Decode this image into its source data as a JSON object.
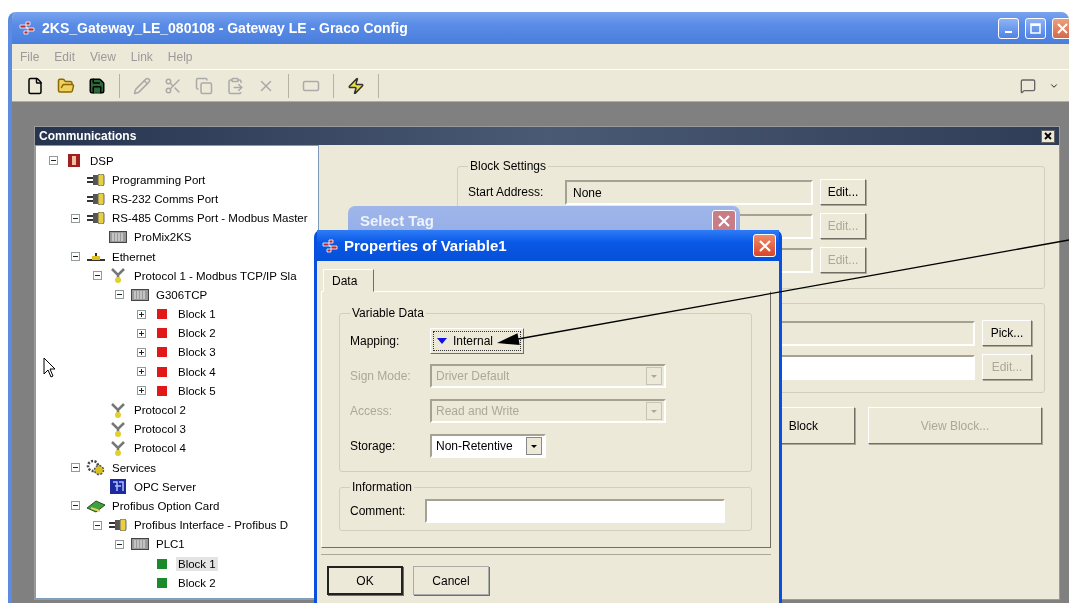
{
  "window": {
    "title": "2KS_Gateway_LE_080108 - Gateway LE - Graco Config"
  },
  "menu": [
    "File",
    "Edit",
    "View",
    "Link",
    "Help"
  ],
  "child_window": {
    "title": "Communications",
    "tree": [
      {
        "label": "DSP",
        "kind": "rack",
        "expanded": true,
        "selected": false,
        "children": [
          {
            "label": "Programming Port",
            "kind": "port",
            "selected": false
          },
          {
            "label": "RS-232 Comms Port",
            "kind": "port",
            "selected": false
          },
          {
            "label": "RS-485 Comms Port - Modbus Master",
            "kind": "port",
            "expanded": true,
            "selected": false,
            "children": [
              {
                "label": "ProMix2KS",
                "kind": "device",
                "selected": false
              }
            ]
          },
          {
            "label": "Ethernet",
            "kind": "network",
            "expanded": true,
            "selected": false,
            "children": [
              {
                "label": "Protocol 1 - Modbus TCP/IP Sla",
                "kind": "protocol",
                "expanded": true,
                "selected": false,
                "children": [
                  {
                    "label": "G306TCP",
                    "kind": "device",
                    "expanded": true,
                    "selected": false,
                    "children": [
                      {
                        "label": "Block 1",
                        "kind": "block",
                        "color": "#e01818",
                        "expanded": false,
                        "selected": false
                      },
                      {
                        "label": "Block 2",
                        "kind": "block",
                        "color": "#e01818",
                        "expanded": false,
                        "selected": false
                      },
                      {
                        "label": "Block 3",
                        "kind": "block",
                        "color": "#e01818",
                        "expanded": false,
                        "selected": false
                      },
                      {
                        "label": "Block 4",
                        "kind": "block",
                        "color": "#e01818",
                        "expanded": false,
                        "selected": false
                      },
                      {
                        "label": "Block 5",
                        "kind": "block",
                        "color": "#e01818",
                        "expanded": false,
                        "selected": false
                      }
                    ]
                  }
                ]
              },
              {
                "label": "Protocol 2",
                "kind": "protocol",
                "selected": false
              },
              {
                "label": "Protocol 3",
                "kind": "protocol",
                "selected": false
              },
              {
                "label": "Protocol 4",
                "kind": "protocol",
                "selected": false
              }
            ]
          },
          {
            "label": "Services",
            "kind": "services",
            "expanded": true,
            "selected": false,
            "children": [
              {
                "label": "OPC Server",
                "kind": "server",
                "selected": false
              }
            ]
          },
          {
            "label": "Profibus Option Card",
            "kind": "card",
            "expanded": true,
            "selected": false,
            "children": [
              {
                "label": "Profibus Interface - Profibus D",
                "kind": "port",
                "expanded": true,
                "selected": false,
                "children": [
                  {
                    "label": "PLC1",
                    "kind": "device",
                    "expanded": true,
                    "selected": false,
                    "children": [
                      {
                        "label": "Block 1",
                        "kind": "block",
                        "color": "#1a8a2a",
                        "selected": true
                      },
                      {
                        "label": "Block 2",
                        "kind": "block",
                        "color": "#1a8a2a",
                        "selected": false
                      }
                    ]
                  }
                ]
              }
            ]
          }
        ]
      }
    ],
    "block_settings": {
      "title": "Block Settings",
      "start_address": {
        "label": "Start Address:",
        "value": "None"
      },
      "buttons": [
        {
          "label": "Edit...",
          "disabled": false
        },
        {
          "label": "Edit...",
          "disabled": true
        },
        {
          "label": "Edit...",
          "disabled": true
        }
      ]
    },
    "tag_settings": {
      "buttons": [
        {
          "label": "Pick...",
          "disabled": false
        },
        {
          "label": "Edit...",
          "disabled": true
        }
      ]
    },
    "actions": [
      {
        "label": "Block",
        "disabled": false
      },
      {
        "label": "View Block...",
        "disabled": true
      }
    ]
  },
  "dialogs": {
    "select_tag": {
      "title": "Select Tag"
    },
    "properties": {
      "title": "Properties of Variable1",
      "tabs": [
        {
          "label": "Data",
          "selected": true
        }
      ],
      "variable_data": {
        "title": "Variable Data",
        "fields": [
          {
            "kind": "button",
            "label": "Mapping:",
            "value": "Internal",
            "disabled": false
          },
          {
            "kind": "combo",
            "label": "Sign Mode:",
            "value": "Driver Default",
            "disabled": true
          },
          {
            "kind": "combo",
            "label": "Access:",
            "value": "Read and Write",
            "disabled": true
          },
          {
            "kind": "combo",
            "label": "Storage:",
            "value": "Non-Retentive",
            "disabled": false
          }
        ]
      },
      "information": {
        "title": "Information",
        "fields": [
          {
            "label": "Comment:"
          }
        ]
      },
      "buttons": [
        {
          "label": "OK",
          "default": true
        },
        {
          "label": "Cancel",
          "default": false
        }
      ]
    }
  }
}
